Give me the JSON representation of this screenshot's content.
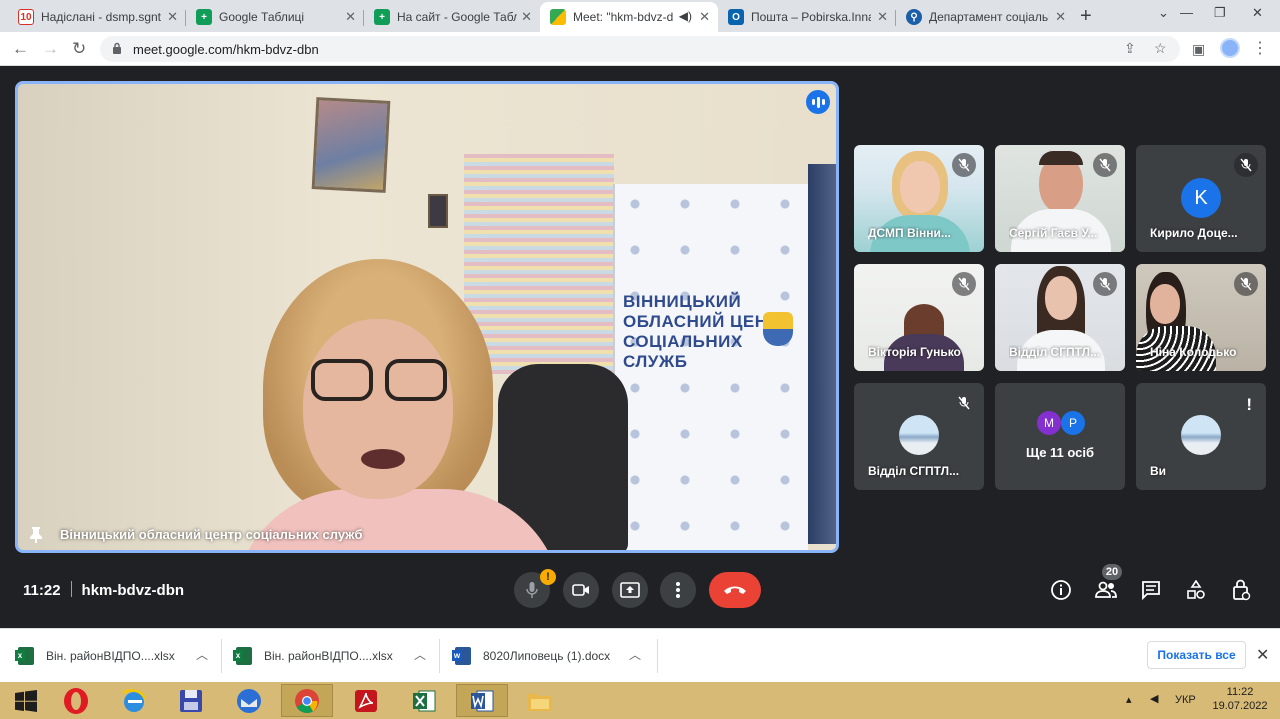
{
  "browser": {
    "tabs": [
      {
        "title": "Надіслані - dsmp.sgnt@",
        "favicon": "ukrnet-icon",
        "active": false
      },
      {
        "title": "Google Таблиці",
        "favicon": "sheets-icon",
        "active": false
      },
      {
        "title": "На сайт - Google Табл",
        "favicon": "sheets-icon",
        "active": false
      },
      {
        "title": "Meet: \"hkm-bdvz-d",
        "favicon": "meet-icon",
        "active": true
      },
      {
        "title": "Пошта – Pobirska.Inna",
        "favicon": "outlook-icon",
        "active": false
      },
      {
        "title": "Департамент соціальн",
        "favicon": "gov-icon",
        "active": false
      }
    ],
    "url": "meet.google.com/hkm-bdvz-dbn"
  },
  "meet": {
    "speaker": {
      "name": "Вінницький обласний центр соціальних служб",
      "banner_text": "ВІННИЦЬКИЙ ОБЛАСНИЙ ЦЕНТР СОЦІАЛЬНИХ СЛУЖБ"
    },
    "tiles": [
      {
        "name": "ДСМП Вінни...",
        "muted": true
      },
      {
        "name": "Сергій Гаєв У...",
        "muted": true
      },
      {
        "name": "Кирило Доце...",
        "muted": true,
        "avatar_letter": "K"
      },
      {
        "name": "Вікторія Гунько",
        "muted": true
      },
      {
        "name": "Відділ СГПТЛ...",
        "muted": true
      },
      {
        "name": "Ніна Колодько",
        "muted": true
      },
      {
        "name": "Відділ СГПТЛ...",
        "muted": true
      },
      {
        "name": "Ще 11 осіб",
        "letters": [
          "M",
          "P"
        ]
      },
      {
        "name": "Ви",
        "warning": "!"
      }
    ],
    "time": "11:22",
    "meeting_code": "hkm-bdvz-dbn",
    "mic_badge": "!",
    "participants_count": "20"
  },
  "downloads": {
    "items": [
      {
        "name": "Він. районВІДПО....xlsx",
        "type": "xlsx"
      },
      {
        "name": "Він. районВІДПО....xlsx",
        "type": "xlsx"
      },
      {
        "name": "8020Липовець (1).docx",
        "type": "docx"
      }
    ],
    "show_all": "Показать все"
  },
  "taskbar": {
    "language": "УКР",
    "time": "11:22",
    "date": "19.07.2022"
  },
  "colors": {
    "meet_bg": "#202124",
    "accent_blue": "#8ab4f8",
    "hangup_red": "#ea4335",
    "taskbar": "#d6ba76"
  }
}
